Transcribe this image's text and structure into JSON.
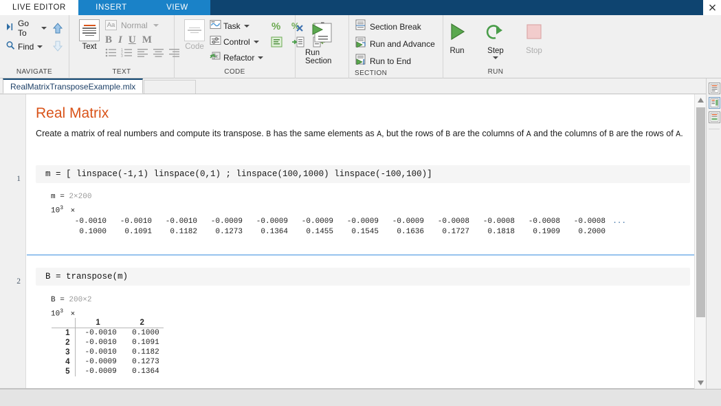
{
  "window": {
    "close_label": "×"
  },
  "top_tabs": [
    {
      "label": "LIVE EDITOR",
      "state": "active"
    },
    {
      "label": "INSERT",
      "state": "highlight"
    },
    {
      "label": "VIEW",
      "state": "highlight"
    }
  ],
  "ribbon": {
    "groups": [
      {
        "name": "navigate",
        "label": "NAVIGATE",
        "items": [
          {
            "label": "Go To",
            "icon": "go-to-icon",
            "has_caret": true
          },
          {
            "label": "Find",
            "icon": "find-icon",
            "has_caret": true
          },
          {
            "label": "",
            "icon": "arrow-up-icon",
            "has_caret": false
          },
          {
            "label": "",
            "icon": "arrow-down-icon",
            "has_caret": false
          }
        ]
      },
      {
        "name": "text",
        "label": "TEXT",
        "text_button": "Text",
        "style_name": "Normal",
        "style_icon": "Aa",
        "format_buttons": [
          "B",
          "I",
          "U",
          "M"
        ],
        "list_buttons": [
          "bulleted-list-icon",
          "numbered-list-icon",
          "align-left-icon",
          "align-center-icon",
          "align-right-icon"
        ]
      },
      {
        "name": "code",
        "label": "CODE",
        "code_button": "Code",
        "items": [
          {
            "label": "Task",
            "icon": "task-icon",
            "has_caret": true
          },
          {
            "label": "Control",
            "icon": "control-icon",
            "has_caret": true
          },
          {
            "label": "Refactor",
            "icon": "refactor-icon",
            "has_caret": true
          }
        ],
        "tool_icons": [
          "comment-icon",
          "uncomment-icon",
          "wrap-comment-icon",
          "smart-indent-icon",
          "increase-indent-icon",
          "decrease-indent-icon"
        ]
      },
      {
        "name": "run-section",
        "label": "",
        "button": "Run Section",
        "icon": "run-section-icon"
      },
      {
        "name": "section",
        "label": "SECTION",
        "items": [
          {
            "label": "Section Break",
            "icon": "section-break-icon"
          },
          {
            "label": "Run and Advance",
            "icon": "run-and-advance-icon"
          },
          {
            "label": "Run to End",
            "icon": "run-to-end-icon"
          }
        ]
      },
      {
        "name": "run",
        "label": "RUN",
        "items": [
          {
            "label": "Run",
            "icon": "run-icon",
            "disabled": false,
            "has_caret": false
          },
          {
            "label": "Step",
            "icon": "step-icon",
            "disabled": false,
            "has_caret": true
          },
          {
            "label": "Stop",
            "icon": "stop-icon",
            "disabled": true,
            "has_caret": false
          }
        ]
      }
    ]
  },
  "document_tab": {
    "filename": "RealMatrixTransposeExample.mlx"
  },
  "document": {
    "title": "Real Matrix",
    "paragraph_parts": [
      {
        "text": "Create a matrix of real numbers and compute its transpose.  ",
        "mono": false
      },
      {
        "text": "B",
        "mono": true
      },
      {
        "text": " has the same elements as ",
        "mono": false
      },
      {
        "text": "A",
        "mono": true
      },
      {
        "text": ", but the rows of ",
        "mono": false
      },
      {
        "text": "B",
        "mono": true
      },
      {
        "text": " are the columns of ",
        "mono": false
      },
      {
        "text": "A",
        "mono": true
      },
      {
        "text": " and the columns of ",
        "mono": false
      },
      {
        "text": "B",
        "mono": true
      },
      {
        "text": " are the rows of ",
        "mono": false
      },
      {
        "text": "A",
        "mono": true
      },
      {
        "text": ".",
        "mono": false
      }
    ],
    "sections": [
      {
        "line_number": "1",
        "code": "m = [ linspace(-1,1) linspace(0,1) ; linspace(100,1000) linspace(-100,100)]",
        "output": {
          "var_name": "m",
          "size": "2×200",
          "scale_base": "10",
          "scale_exp": "3",
          "scale_times": "×",
          "ellipsis": "...",
          "rows": [
            [
              "-0.0010",
              "-0.0010",
              "-0.0010",
              "-0.0009",
              "-0.0009",
              "-0.0009",
              "-0.0009",
              "-0.0009",
              "-0.0008",
              "-0.0008",
              "-0.0008",
              "-0.0008"
            ],
            [
              "0.1000",
              "0.1091",
              "0.1182",
              "0.1273",
              "0.1364",
              "0.1455",
              "0.1545",
              "0.1636",
              "0.1727",
              "0.1818",
              "0.1909",
              "0.2000"
            ]
          ]
        }
      },
      {
        "line_number": "2",
        "code": "B = transpose(m)",
        "output": {
          "var_name": "B",
          "size": "200×2",
          "scale_base": "10",
          "scale_exp": "3",
          "scale_times": "×",
          "table": {
            "col_headers": [
              "1",
              "2"
            ],
            "rows": [
              {
                "index": "1",
                "values": [
                  "-0.0010",
                  "0.1000"
                ]
              },
              {
                "index": "2",
                "values": [
                  "-0.0010",
                  "0.1091"
                ]
              },
              {
                "index": "3",
                "values": [
                  "-0.0010",
                  "0.1182"
                ]
              },
              {
                "index": "4",
                "values": [
                  "-0.0009",
                  "0.1273"
                ]
              },
              {
                "index": "5",
                "values": [
                  "-0.0009",
                  "0.1364"
                ]
              }
            ]
          }
        }
      }
    ]
  },
  "right_panel": {
    "icons": [
      "output-inline-icon",
      "output-right-icon",
      "output-hidden-icon"
    ],
    "selected_index": 1
  },
  "scrollbar": {
    "up_arrow": "▲",
    "down_arrow": "▼"
  },
  "colors": {
    "accent_blue": "#0e4470",
    "tab_highlight": "#1a82c8",
    "title_orange": "#d95319",
    "section_divider": "#3a8dde",
    "code_bg": "#f5f5f5"
  }
}
